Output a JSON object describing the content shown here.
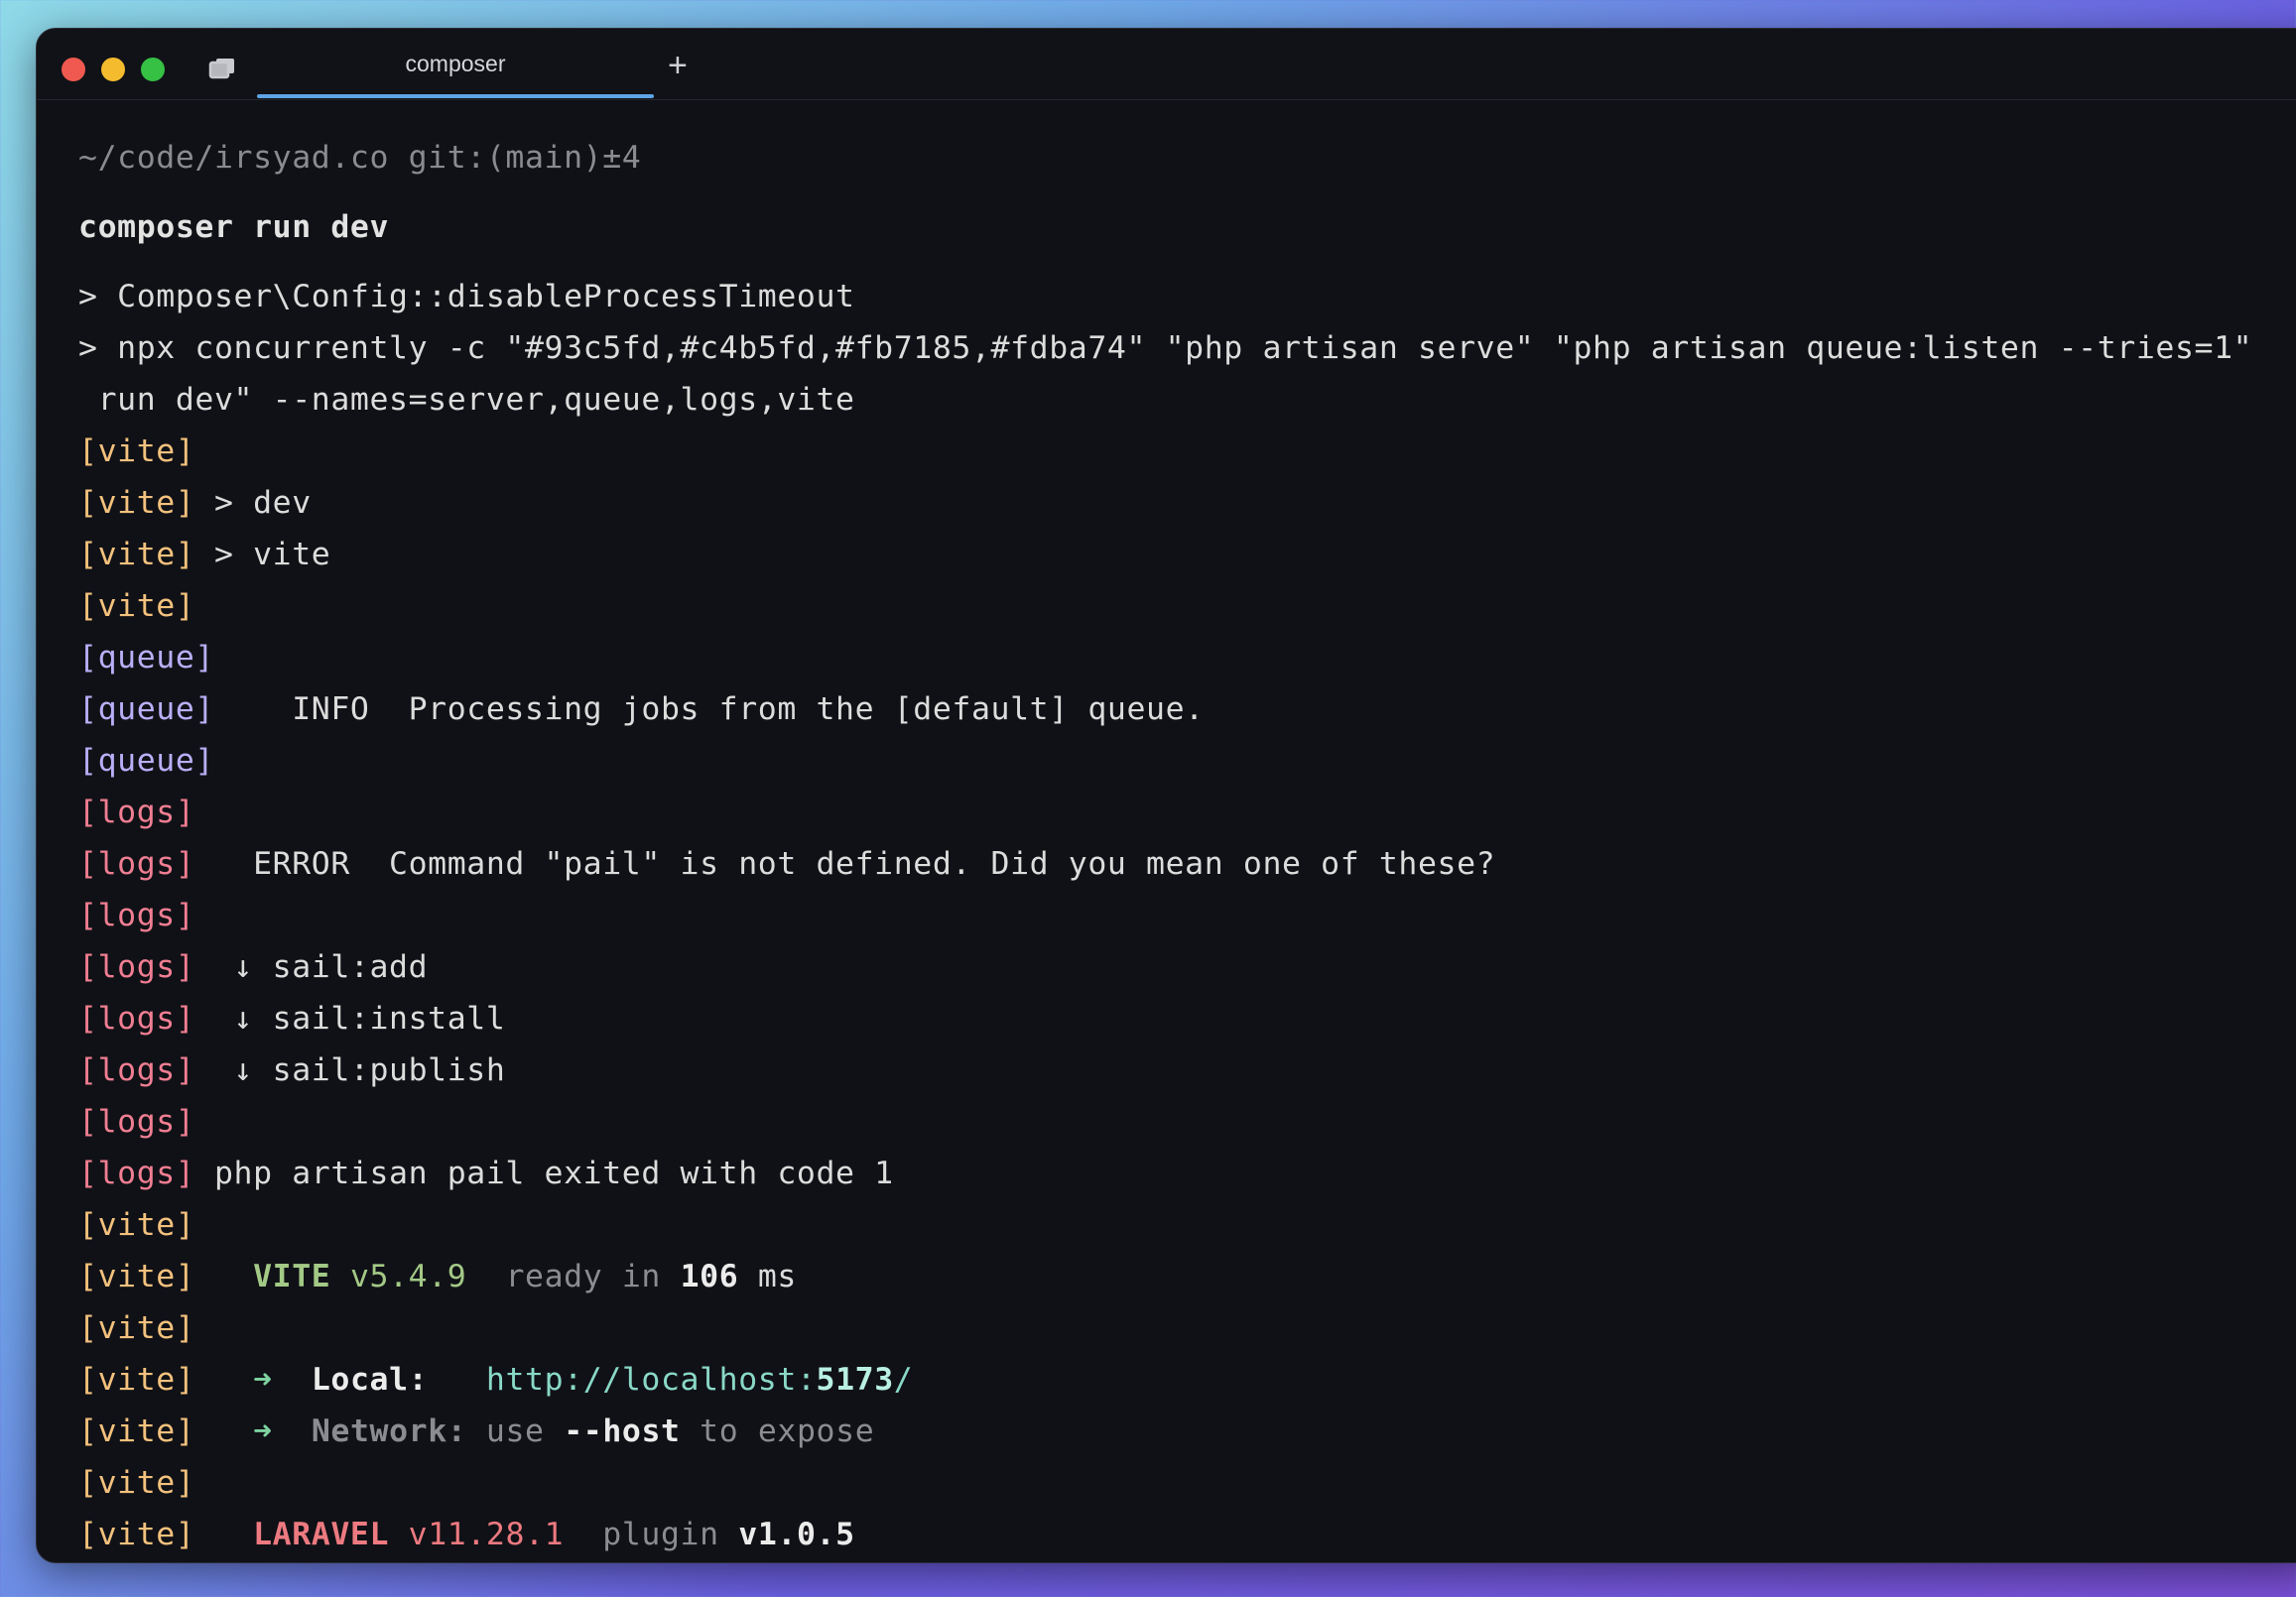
{
  "window": {
    "tab_title": "composer",
    "new_tab_symbol": "+"
  },
  "terminal": {
    "prompt": "~/code/irsyad.co git:(main)±4",
    "command": "composer run dev",
    "lines": {
      "l1": "> Composer\\Config::disableProcessTimeout",
      "l2": "> npx concurrently -c \"#93c5fd,#c4b5fd,#fb7185,#fdba74\" \"php artisan serve\" \"php artisan queue:listen --tries=1\"",
      "l2b": " run dev\" --names=server,queue,logs,vite",
      "prefix_vite": "[vite]",
      "prefix_queue": "[queue]",
      "prefix_logs": "[logs]",
      "dev": " > dev",
      "vite": " > vite",
      "queue_info": "    INFO  Processing jobs from the [default] queue.",
      "logs_error": "   ERROR  Command \"pail\" is not defined. Did you mean one of these?",
      "sail_add": "  ↓ sail:add",
      "sail_install": "  ↓ sail:install",
      "sail_publish": "  ↓ sail:publish",
      "pail_exit": " php artisan pail exited with code 1",
      "vite_label": "VITE",
      "vite_version": "v5.4.9",
      "ready_in": "ready in",
      "ready_ms": "106",
      "ms": "ms",
      "arrow": "➜",
      "local_label": "Local:",
      "local_url_base": "http://localhost:",
      "local_url_port": "5173",
      "local_url_tail": "/",
      "network_label": "Network:",
      "use": "use",
      "host_flag": "--host",
      "to_expose": "to expose",
      "laravel_label": "LARAVEL",
      "laravel_version": "v11.28.1",
      "plugin": "plugin",
      "plugin_version": "v1.0.5"
    }
  }
}
